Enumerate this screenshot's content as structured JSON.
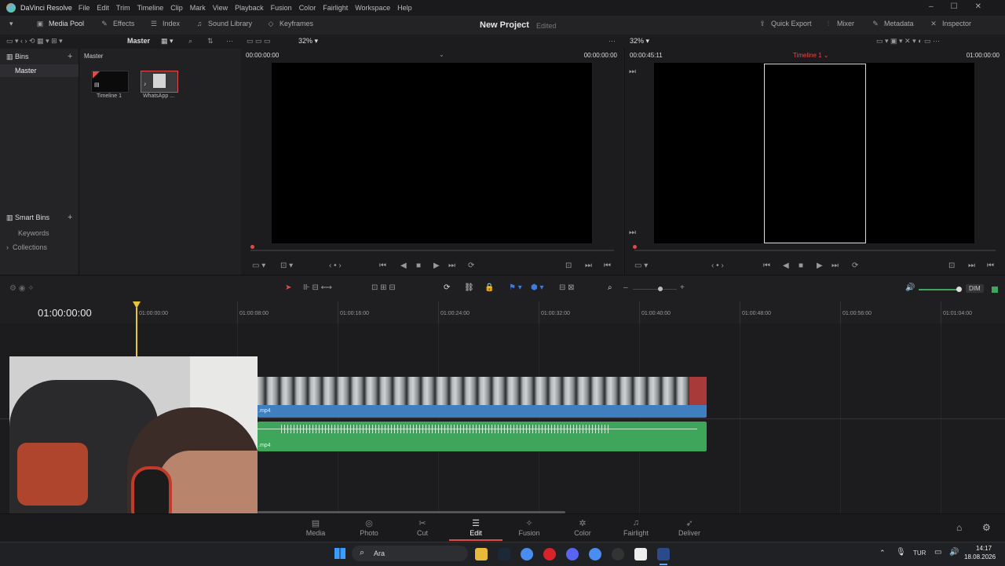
{
  "app": {
    "name": "DaVinci Resolve"
  },
  "menu": [
    "File",
    "Edit",
    "Trim",
    "Timeline",
    "Clip",
    "Mark",
    "View",
    "Playback",
    "Fusion",
    "Color",
    "Fairlight",
    "Workspace",
    "Help"
  ],
  "toolbar": {
    "media_pool": "Media Pool",
    "effects": "Effects",
    "index": "Index",
    "sound_library": "Sound Library",
    "keyframes": "Keyframes",
    "project_title": "New Project",
    "project_state": "Edited",
    "quick_export": "Quick Export",
    "mixer": "Mixer",
    "metadata": "Metadata",
    "inspector": "Inspector"
  },
  "toolbar2": {
    "master_label": "Master",
    "zoom_left": "32%",
    "zoom_right": "32%"
  },
  "bins": {
    "header": "Bins",
    "items": [
      "Master"
    ],
    "smart_header": "Smart Bins",
    "smart_items": [
      "Keywords",
      "Collections"
    ]
  },
  "media_pool": {
    "path": "Master",
    "clips": [
      {
        "name": "Timeline 1"
      },
      {
        "name": "WhatsApp ..."
      }
    ]
  },
  "source_viewer": {
    "tc_left": "00:00:00:00",
    "tc_right": "00:00:00:00"
  },
  "timeline_viewer": {
    "duration": "00:00:45:11",
    "timeline_name": "Timeline 1",
    "tc": "01:00:00:00"
  },
  "timeline": {
    "current_tc": "01:00:00:00",
    "ticks": [
      "01:00:00:00",
      "01:00:08:00",
      "01:00:16:00",
      "01:00:24:00",
      "01:00:32:00",
      "01:00:40:00",
      "01:00:48:00",
      "01:00:56:00",
      "01:01:04:00"
    ],
    "video_clip_label": ".mp4",
    "audio_clip_label": ".mp4",
    "dim": "DIM"
  },
  "pages": [
    "Media",
    "Photo",
    "Cut",
    "Edit",
    "Fusion",
    "Color",
    "Fairlight",
    "Deliver"
  ],
  "active_page": "Edit",
  "taskbar": {
    "search": "Ara",
    "lang": "TUR",
    "time": "14:17",
    "date": "18.08.2026"
  },
  "colors": {
    "accent_red": "#e04a4a",
    "video_clip": "#3f7fbf",
    "audio_clip": "#3fa55a",
    "playhead": "#e8c534"
  }
}
